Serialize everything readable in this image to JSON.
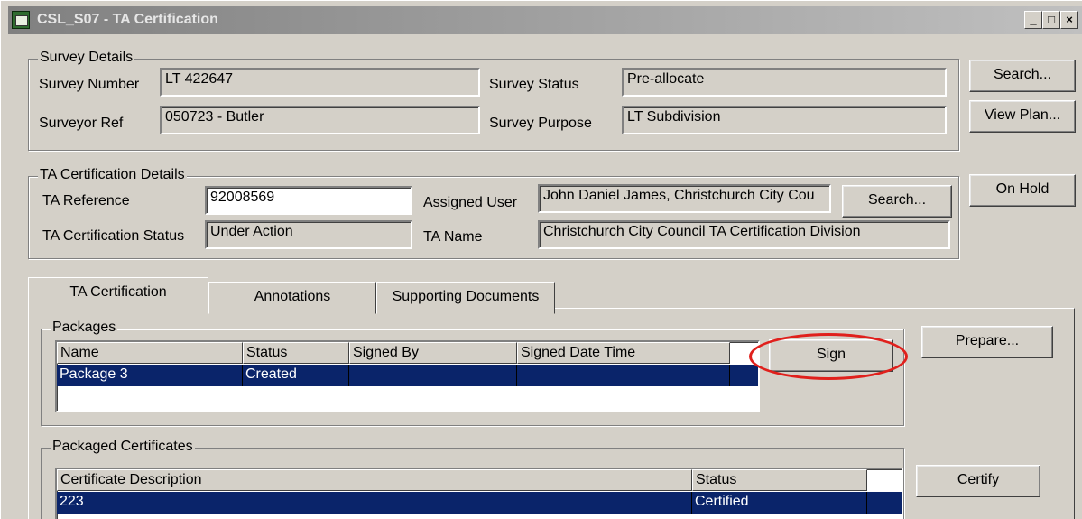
{
  "window": {
    "title": "CSL_S07 - TA Certification",
    "minimize_glyph": "_",
    "maximize_glyph": "□",
    "close_glyph": "×"
  },
  "survey_details": {
    "group_label": "Survey Details",
    "survey_number_label": "Survey Number",
    "survey_number_value": "LT 422647",
    "surveyor_ref_label": "Surveyor Ref",
    "surveyor_ref_value": "050723 - Butler",
    "survey_status_label": "Survey Status",
    "survey_status_value": "Pre-allocate",
    "survey_purpose_label": "Survey Purpose",
    "survey_purpose_value": "LT Subdivision"
  },
  "side_buttons": {
    "search": "Search...",
    "view_plan": "View Plan...",
    "on_hold": "On Hold"
  },
  "ta_details": {
    "group_label": "TA Certification Details",
    "ta_reference_label": "TA Reference",
    "ta_reference_value": "92008569",
    "ta_status_label": "TA Certification Status",
    "ta_status_value": "Under Action",
    "assigned_user_label": "Assigned User",
    "assigned_user_value": "John Daniel James, Christchurch City Cou",
    "ta_name_label": "TA Name",
    "ta_name_value": "Christchurch City Council TA Certification Division",
    "search_button": "Search..."
  },
  "tabs": [
    {
      "label": "TA Certification",
      "active": true
    },
    {
      "label": "Annotations",
      "active": false
    },
    {
      "label": "Supporting Documents",
      "active": false
    }
  ],
  "packages": {
    "group_label": "Packages",
    "columns": [
      "Name",
      "Status",
      "Signed By",
      "Signed Date Time"
    ],
    "rows": [
      {
        "name": "Package 3",
        "status": "Created",
        "signed_by": "",
        "signed_date_time": ""
      }
    ],
    "sign_button": "Sign",
    "prepare_button": "Prepare..."
  },
  "packaged_certificates": {
    "group_label": "Packaged Certificates",
    "columns": [
      "Certificate Description",
      "Status"
    ],
    "rows": [
      {
        "description": "223",
        "status": "Certified"
      }
    ],
    "certify_button": "Certify"
  },
  "colors": {
    "face": "#d4d0c8",
    "selection": "#0a246a",
    "annotation_circle": "#e0201c"
  }
}
